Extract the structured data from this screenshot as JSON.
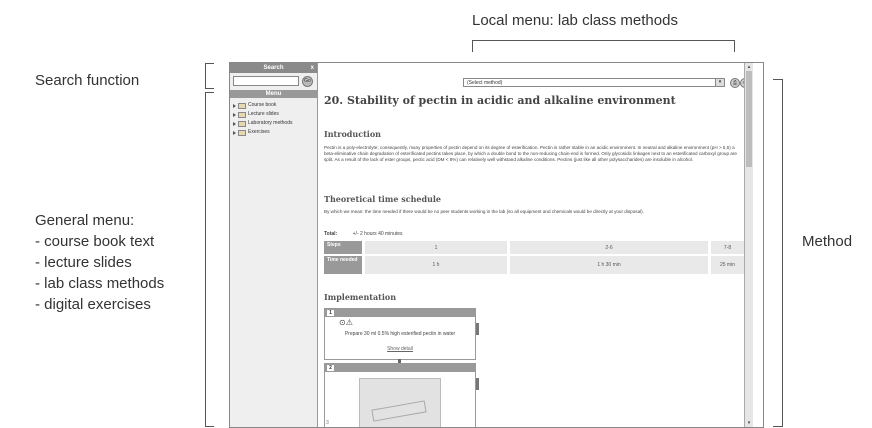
{
  "annotations": {
    "local_menu": "Local menu: lab class methods",
    "search": "Search function",
    "general_menu": {
      "heading": "General menu:",
      "items": [
        "- course book text",
        "- lecture slides",
        "- lab class methods",
        "- digital exercises"
      ]
    },
    "method": "Method"
  },
  "sidebar": {
    "search_header": "Search",
    "close_label": "x",
    "go_label": "Go",
    "menu_header": "Menu",
    "tree": [
      {
        "label": "Course book"
      },
      {
        "label": "Lecture slides"
      },
      {
        "label": "Laboratory methods"
      },
      {
        "label": "Exercises"
      }
    ]
  },
  "main": {
    "method_select": "(Select method)",
    "title": "20. Stability of pectin in acidic and alkaline environment",
    "intro_heading": "Introduction",
    "intro_text": "Pectin is a poly-electrolyte; consequently, many properties of pectin depend on its degree of esterification. Pectin is rather stable in an acidic environment. In neutral and alkaline environment (pH > 5,5) a beta-eliminative chain degradation of esterificated pectins takes place, by which a double bond to the non-reducing chain-end is formed. Only glycosidic linkages next to an esterificated carboxyl group are split. As a result of the lack of ester groups, pectic acid (DM < 8%) can relatively well withstand alkaline conditions. Pectins (just like all other polysaccharides) are insoluble in alcohol.",
    "schedule_heading": "Theoretical time schedule",
    "schedule_text": "By which we mean: the time needed if there would be no peer students working in the lab (so all equipment and chemicals would be directly at your disposal).",
    "total_label": "Total:",
    "total_value": "+/- 2 hours 40 minutes",
    "schedule": {
      "steps_label": "Steps",
      "time_label": "Time needed",
      "columns": [
        {
          "steps": "1",
          "time": "1 h"
        },
        {
          "steps": "2-6",
          "time": "1 h 30 min"
        },
        {
          "steps": "7-8",
          "time": "25 min"
        }
      ]
    },
    "implementation_heading": "Implementation",
    "step1": {
      "number": "1",
      "icons": "⊙⚠",
      "text": "Prepare 30 ml 0.5% high esterified pectin in water",
      "detail_link": "Show detail"
    },
    "step2": {
      "number": "2"
    },
    "step3_number": "3"
  }
}
